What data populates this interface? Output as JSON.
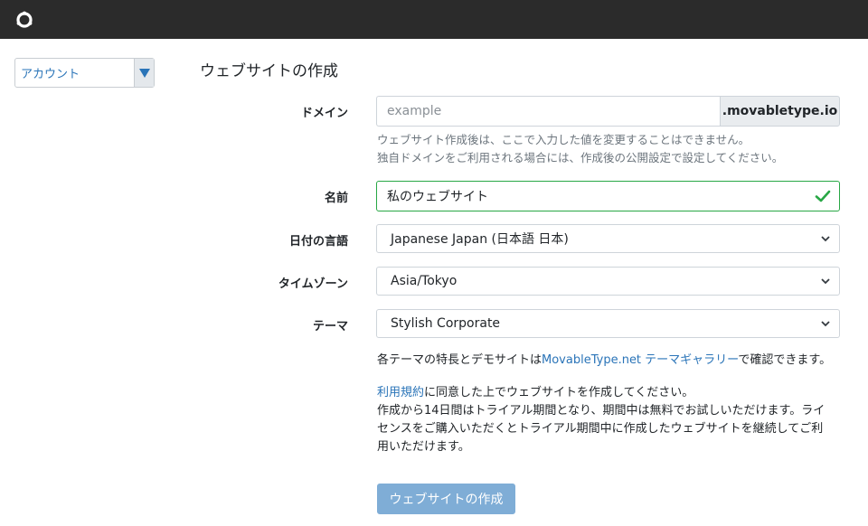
{
  "header": {
    "logo_icon": "movabletype-logo-icon",
    "bg_color": "#2b2b2b"
  },
  "sidebar": {
    "account_select": {
      "selected": "アカウント"
    }
  },
  "main": {
    "title": "ウェブサイトの作成",
    "domain": {
      "label": "ドメイン",
      "placeholder": "example",
      "value": "",
      "suffix": ".movabletype.io",
      "help_line1": "ウェブサイト作成後は、ここで入力した値を変更することはできません。",
      "help_line2": "独自ドメインをご利用される場合には、作成後の公開設定で設定してください。"
    },
    "name": {
      "label": "名前",
      "value": "私のウェブサイト",
      "valid_color": "#28a745"
    },
    "language": {
      "label": "日付の言語",
      "selected": "Japanese Japan (日本語 日本)"
    },
    "timezone": {
      "label": "タイムゾーン",
      "selected": "Asia/Tokyo"
    },
    "theme": {
      "label": "テーマ",
      "selected": "Stylish Corporate",
      "note_prefix": "各テーマの特長とデモサイトは",
      "note_link": "MovableType.net テーマギャラリー",
      "note_suffix": "で確認できます。"
    },
    "terms": {
      "link": "利用規約",
      "line1_suffix": "に同意した上でウェブサイトを作成してください。",
      "line2": "作成から14日間はトライアル期間となり、期間中は無料でお試しいただけます。ライ",
      "line3": "センスをご購入いただくとトライアル期間中に作成したウェブサイトを継続してご利",
      "line4": "用いただけます。"
    },
    "submit_label": "ウェブサイトの作成",
    "accent_color": "#2a74b8"
  }
}
